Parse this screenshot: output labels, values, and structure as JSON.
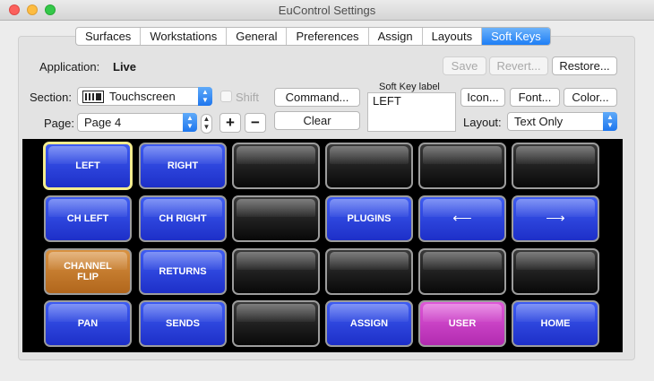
{
  "window": {
    "title": "EuControl Settings"
  },
  "tabs": [
    "Surfaces",
    "Workstations",
    "General",
    "Preferences",
    "Assign",
    "Layouts",
    "Soft Keys"
  ],
  "active_tab": "Soft Keys",
  "application": {
    "label": "Application:",
    "value": "Live"
  },
  "actions": {
    "save": "Save",
    "revert": "Revert...",
    "restore": "Restore..."
  },
  "section": {
    "label": "Section:",
    "value": "Touchscreen"
  },
  "shift": {
    "label": "Shift",
    "checked": false
  },
  "page": {
    "label": "Page:",
    "value": "Page 4"
  },
  "plus": "+",
  "minus": "−",
  "command_button": "Command...",
  "clear_button": "Clear",
  "soft_key_label": {
    "title": "Soft Key label",
    "value": "LEFT"
  },
  "icon_button": "Icon...",
  "font_button": "Font...",
  "color_button": "Color...",
  "layout": {
    "label": "Layout:",
    "value": "Text Only"
  },
  "colors": {
    "blue": "#2a3ee0",
    "orange": "#c87a2e",
    "pink": "#cc41c8",
    "empty": "#1c1c1c",
    "selection": "#f4ec8e",
    "accent": "#1e7ef5"
  },
  "keys": [
    [
      {
        "text": "LEFT",
        "color": "blue",
        "selected": true
      },
      {
        "text": "RIGHT",
        "color": "blue"
      },
      {
        "text": "",
        "color": "empty"
      },
      {
        "text": "",
        "color": "empty"
      },
      {
        "text": "",
        "color": "empty"
      },
      {
        "text": "",
        "color": "empty"
      }
    ],
    [
      {
        "text": "CH LEFT",
        "color": "blue"
      },
      {
        "text": "CH RIGHT",
        "color": "blue"
      },
      {
        "text": "",
        "color": "empty"
      },
      {
        "text": "PLUGINS",
        "color": "blue"
      },
      {
        "text": "⟵",
        "color": "blue",
        "icon": "left-arrow-icon"
      },
      {
        "text": "⟶",
        "color": "blue",
        "icon": "right-arrow-icon"
      }
    ],
    [
      {
        "text": "CHANNEL\nFLIP",
        "color": "orange"
      },
      {
        "text": "RETURNS",
        "color": "blue"
      },
      {
        "text": "",
        "color": "empty"
      },
      {
        "text": "",
        "color": "empty"
      },
      {
        "text": "",
        "color": "empty"
      },
      {
        "text": "",
        "color": "empty"
      }
    ],
    [
      {
        "text": "PAN",
        "color": "blue"
      },
      {
        "text": "SENDS",
        "color": "blue"
      },
      {
        "text": "",
        "color": "empty"
      },
      {
        "text": "ASSIGN",
        "color": "blue"
      },
      {
        "text": "USER",
        "color": "pink"
      },
      {
        "text": "HOME",
        "color": "blue"
      }
    ]
  ]
}
